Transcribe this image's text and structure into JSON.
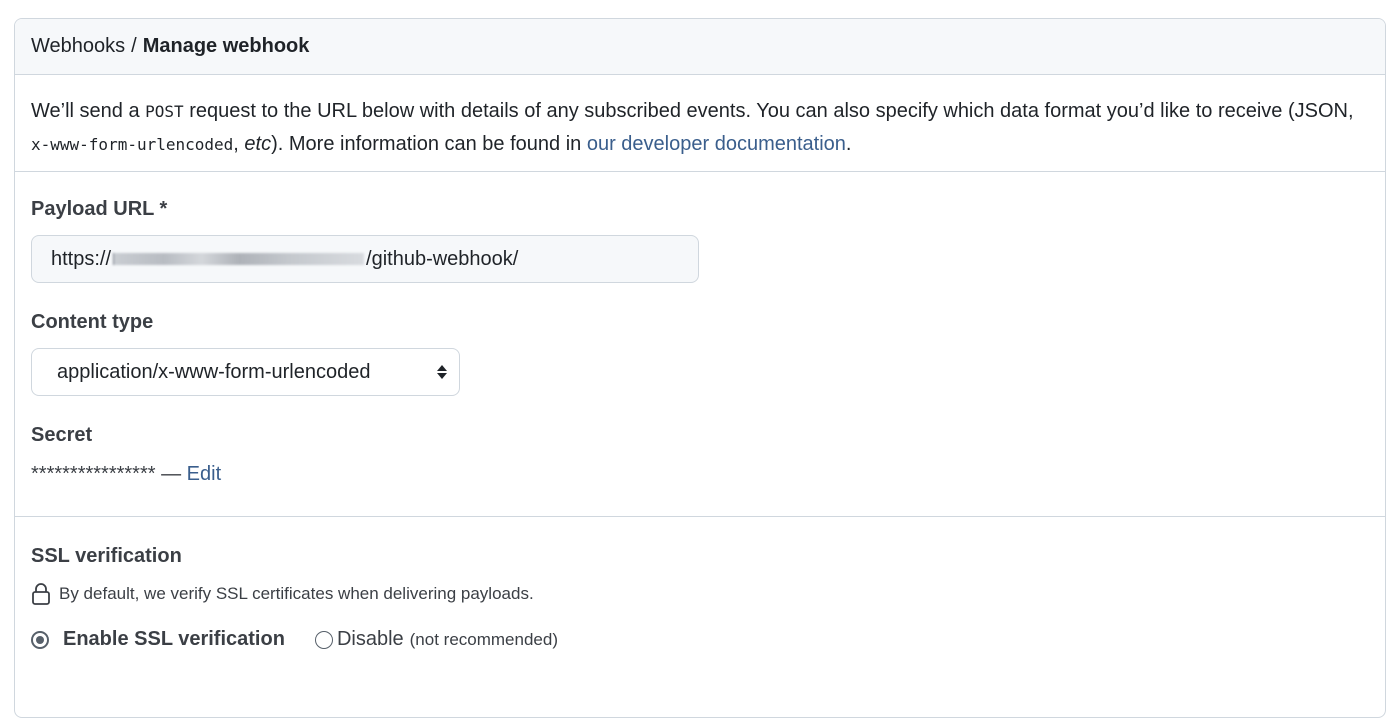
{
  "breadcrumb": {
    "parent": "Webhooks",
    "separator": "/",
    "current": "Manage webhook"
  },
  "intro": {
    "part1": "We’ll send a ",
    "code_method": "POST",
    "part2": " request to the URL below with details of any subscribed events. You can also specify which data format you’d like to receive (JSON, ",
    "code_format": "x-www-form-urlencoded",
    "part3": ", ",
    "etc": "etc",
    "part4": "). More information can be found in ",
    "link_text": "our developer documentation",
    "part5": "."
  },
  "payload": {
    "label": "Payload URL *",
    "url_prefix": "https://",
    "url_suffix": "/github-webhook/"
  },
  "content_type": {
    "label": "Content type",
    "selected": "application/x-www-form-urlencoded"
  },
  "secret": {
    "label": "Secret",
    "masked": "****************",
    "dash": " — ",
    "edit_label": "Edit"
  },
  "ssl": {
    "label": "SSL verification",
    "note": "By default, we verify SSL certificates when delivering payloads.",
    "enable_label": "Enable SSL verification",
    "disable_label": "Disable",
    "disable_hint": "(not recommended)",
    "selected": "enable"
  },
  "icons": {
    "lock": "lock-icon",
    "select_arrows": "chevron-up-down-icon"
  }
}
